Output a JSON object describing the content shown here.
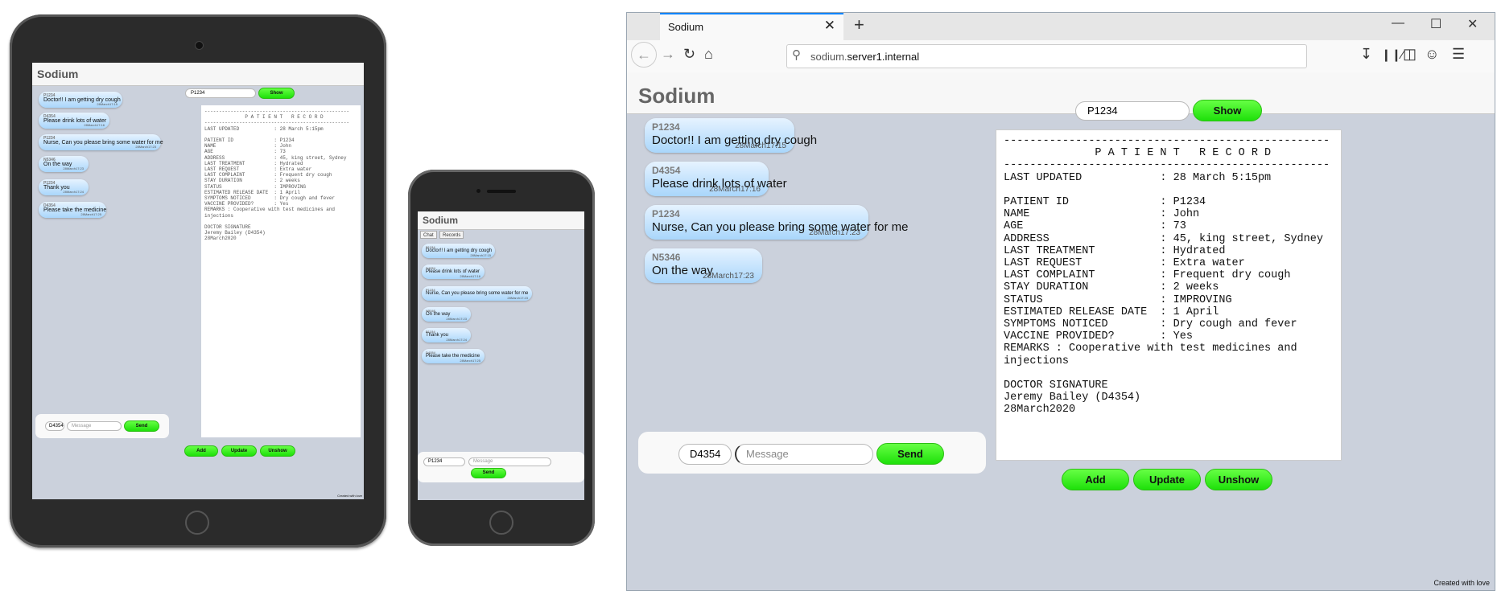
{
  "app": {
    "name": "Sodium",
    "footer": "Created with love"
  },
  "browser": {
    "tab_title": "Sodium",
    "url_host": "sodium.",
    "url_rest": "server1.internal",
    "new_tab_symbol": "+",
    "close_symbol": "✕"
  },
  "messages": [
    {
      "sender": "P1234",
      "text": "Doctor!! I am getting dry cough",
      "time": "28March17:15"
    },
    {
      "sender": "D4354",
      "text": "Please drink lots of water",
      "time": "28March17:16"
    },
    {
      "sender": "P1234",
      "text": "Nurse, Can you please bring some water for me",
      "time": "28March17:23"
    },
    {
      "sender": "N5346",
      "text": "On the way",
      "time": "28March17:23"
    },
    {
      "sender": "P1234",
      "text": "Thank you",
      "time": "28March17:24"
    },
    {
      "sender": "D4354",
      "text": "Please take the medicine",
      "time": "28March17:25"
    }
  ],
  "patient_search": {
    "value": "P1234",
    "show_label": "Show"
  },
  "compose": {
    "sender_id": "D4354",
    "message_placeholder": "Message",
    "send_label": "Send"
  },
  "actions": {
    "add": "Add",
    "update": "Update",
    "unshow": "Unshow"
  },
  "phone": {
    "tab_chat": "Chat",
    "tab_records": "Records",
    "compose_id": "P1234"
  },
  "record_text": "--------------------------------------------------\n              P A T I E N T   R E C O R D\n--------------------------------------------------\nLAST UPDATED            : 28 March 5:15pm\n\nPATIENT ID              : P1234\nNAME                    : John\nAGE                     : 73\nADDRESS                 : 45, king street, Sydney\nLAST TREATMENT          : Hydrated\nLAST REQUEST            : Extra water\nLAST COMPLAINT          : Frequent dry cough\nSTAY DURATION           : 2 weeks\nSTATUS                  : IMPROVING\nESTIMATED RELEASE DATE  : 1 April\nSYMPTOMS NOTICED        : Dry cough and fever\nVACCINE PROVIDED?       : Yes\nREMARKS : Cooperative with test medicines and injections\n\nDOCTOR SIGNATURE\nJeremy Bailey (D4354)\n28March2020"
}
